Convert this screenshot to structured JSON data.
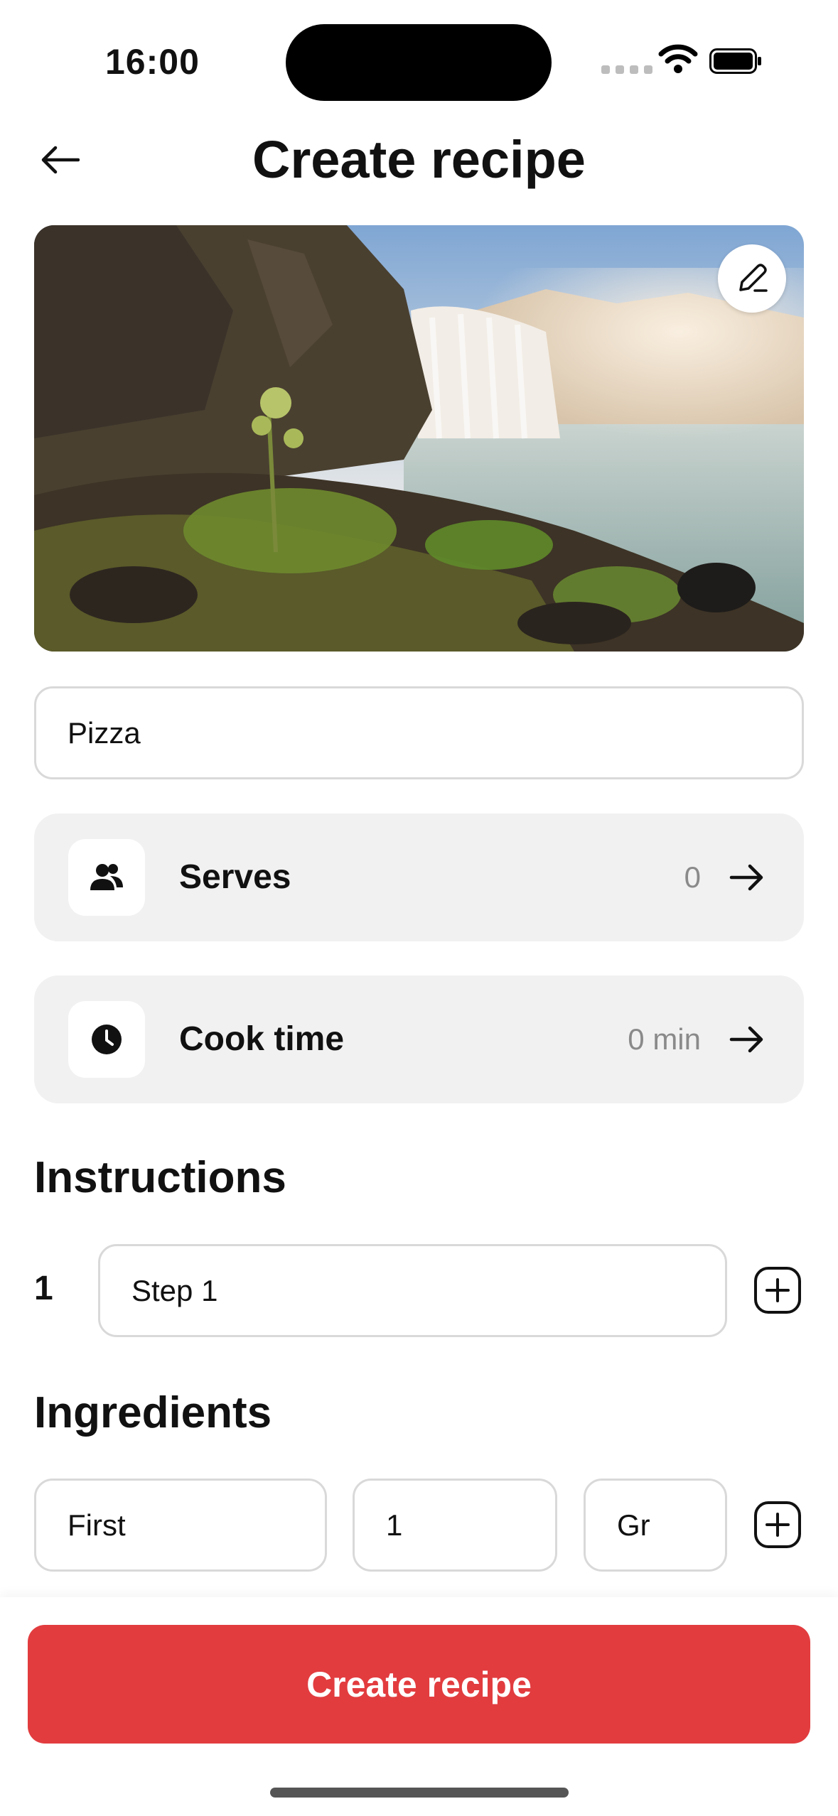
{
  "status_bar": {
    "time": "16:00"
  },
  "header": {
    "title": "Create recipe"
  },
  "recipe": {
    "title_value": "Pizza"
  },
  "options": {
    "serves": {
      "label": "Serves",
      "value": "0"
    },
    "cook_time": {
      "label": "Cook time",
      "value": "0 min"
    }
  },
  "instructions": {
    "heading": "Instructions",
    "steps": [
      {
        "number": "1",
        "value": "Step 1"
      }
    ]
  },
  "ingredients": {
    "heading": "Ingredients",
    "items": [
      {
        "name": "First",
        "quantity": "1",
        "unit": "Gr"
      }
    ]
  },
  "footer": {
    "create_label": "Create recipe"
  },
  "colors": {
    "accent": "#e23c3f",
    "card_bg": "#f1f1f1",
    "border": "#d9d9d9"
  },
  "icons": [
    "back-arrow-icon",
    "pencil-icon",
    "people-icon",
    "clock-icon",
    "arrow-right-icon",
    "plus-square-icon"
  ]
}
